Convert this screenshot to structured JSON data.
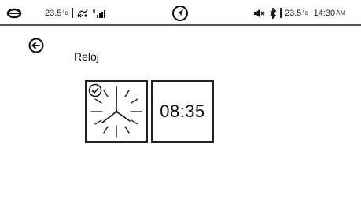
{
  "status_bar": {
    "temp_left": "23.5",
    "temp_left_unit": "°c",
    "temp_right": "23.5",
    "temp_right_unit": "°c",
    "time": "14:30",
    "time_suffix": "AM",
    "icons": [
      "ring-icon",
      "fan-icon",
      "signal-icon",
      "navigation-icon",
      "mute-icon",
      "bluetooth-icon"
    ]
  },
  "page": {
    "title": "Reloj"
  },
  "clock_options": {
    "analog": {
      "selected": true,
      "icon": "check-circle-icon"
    },
    "digital": {
      "time": "08:35",
      "selected": false
    }
  },
  "colors": {
    "foreground": "#111111",
    "background": "#ffffff",
    "divider": "#555555"
  }
}
